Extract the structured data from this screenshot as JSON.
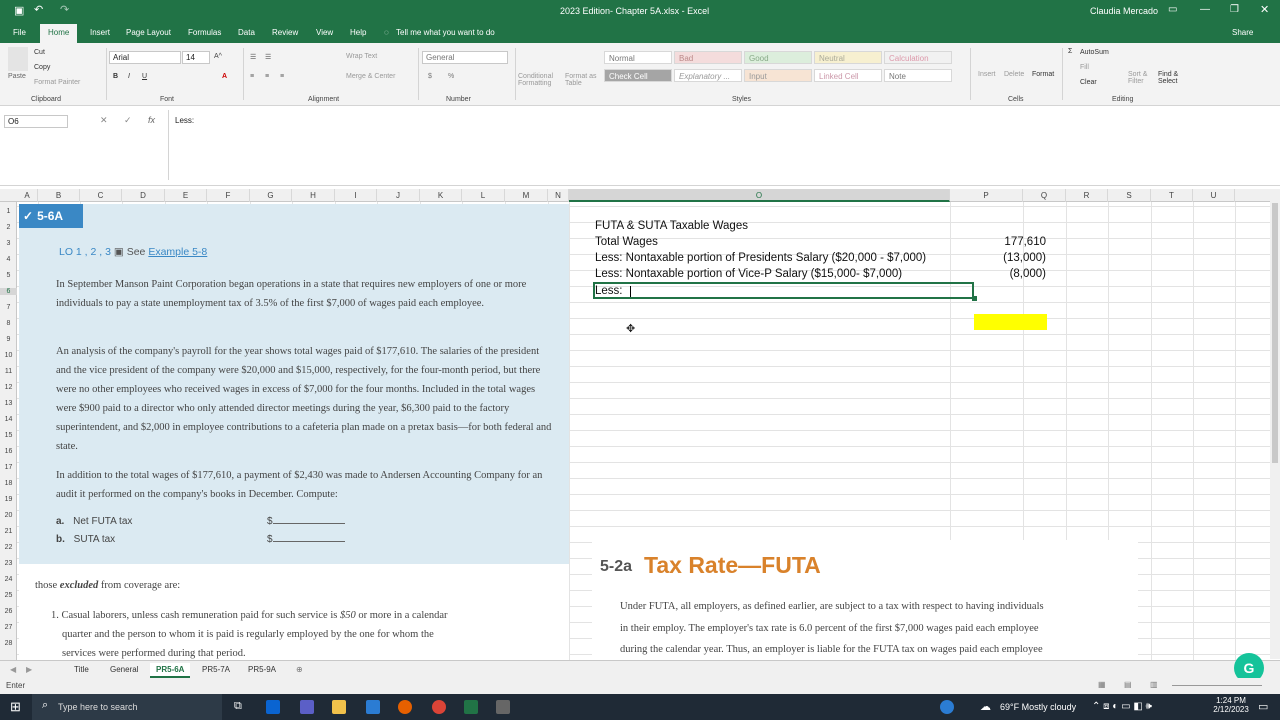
{
  "window": {
    "title": "2023 Edition- Chapter 5A.xlsx  -  Excel",
    "user": "Claudia Mercado"
  },
  "ribbon_tabs": [
    "File",
    "Home",
    "Insert",
    "Page Layout",
    "Formulas",
    "Data",
    "Review",
    "View",
    "Help"
  ],
  "tell_me": "Tell me what you want to do",
  "share": "Share",
  "ribbon": {
    "clipboard": {
      "cut": "Cut",
      "copy": "Copy",
      "format_painter": "Format Painter",
      "paste": "Paste",
      "label": "Clipboard"
    },
    "font": {
      "name": "Arial",
      "size": "14",
      "label": "Font"
    },
    "alignment": {
      "wrap": "Wrap Text",
      "merge": "Merge & Center",
      "label": "Alignment"
    },
    "number": {
      "format": "General",
      "label": "Number"
    },
    "styles": {
      "cond": "Conditional Formatting",
      "table": "Format as Table",
      "cells": [
        "Normal",
        "Bad",
        "Good",
        "Neutral",
        "Calculation",
        "Check Cell",
        "Explanatory ...",
        "Input",
        "Linked Cell",
        "Note"
      ],
      "label": "Styles"
    },
    "cells": {
      "insert": "Insert",
      "delete": "Delete",
      "format": "Format",
      "label": "Cells"
    },
    "editing": {
      "autosum": "AutoSum",
      "fill": "Fill",
      "clear": "Clear",
      "sort": "Sort & Filter",
      "find": "Find & Select",
      "label": "Editing"
    }
  },
  "formula_bar": {
    "name_box": "O6",
    "content": "Less:"
  },
  "columns": [
    "A",
    "B",
    "C",
    "D",
    "E",
    "F",
    "G",
    "H",
    "I",
    "J",
    "K",
    "L",
    "M",
    "N",
    "O",
    "P",
    "Q",
    "R",
    "S",
    "T",
    "U"
  ],
  "rows": [
    "1",
    "2",
    "3",
    "4",
    "5",
    "6",
    "7",
    "8",
    "9",
    "10",
    "11",
    "12",
    "13",
    "14",
    "15",
    "16",
    "17",
    "18",
    "19",
    "20",
    "21",
    "22",
    "23",
    "24",
    "25",
    "26",
    "27",
    "28"
  ],
  "book": {
    "badge": "5-6A",
    "lo": "LO 1 , 2 , 3",
    "see": "See",
    "example": "Example 5-8",
    "para1": "In September Manson Paint Corporation began operations in a state that requires new employers of one or more individuals to pay a state unemployment tax of 3.5% of the first $7,000 of wages paid each employee.",
    "para2": "An analysis of the company's payroll for the year shows total wages paid of $177,610. The salaries of the president and the vice president of the company were $20,000 and $15,000, respectively, for the four-month period, but there were no other employees who received wages in excess of $7,000 for the four months. Included in the total wages were $900 paid to a director who only attended director meetings during the year, $6,300 paid to the factory superintendent, and $2,000 in employee contributions to a cafeteria plan made on a pretax basis—for both federal and state.",
    "para3": "In addition to the total wages of $177,610, a payment of $2,430 was made to Andersen Accounting Company for an audit it performed on the company's books in December. Compute:",
    "qa_letter": "a.",
    "qa_text": "Net FUTA tax",
    "qb_letter": "b.",
    "qb_text": "SUTA tax",
    "dollar": "$",
    "excluded_a": "those",
    "excluded_em": "excluded",
    "excluded_b": "from coverage are:",
    "item1_a": "1.  Casual laborers, unless cash remuneration paid for such service is",
    "item1_em": "$50",
    "item1_b": "or more in a calendar",
    "item1_c": "quarter and the person to whom it is paid is regularly employed by the one for whom the",
    "item1_d": "services were performed during that period."
  },
  "book2": {
    "section_num": "5-2a",
    "section_title": "Tax Rate—FUTA",
    "line1": "Under FUTA, all employers, as defined earlier, are subject to a tax with respect to having individuals",
    "line2": "in their employ. The employer's tax rate is 6.0 percent of the first $7,000 wages paid each employee",
    "line3": "during the calendar year. Thus, an employer is liable for the FUTA tax on wages paid each employee"
  },
  "sheet": {
    "heading": "FUTA & SUTA Taxable Wages",
    "r3_label": "Total Wages",
    "r3_value": "177,610",
    "r4_label": "Less: Nontaxable portion of Presidents Salary ($20,000 - $7,000)",
    "r4_value": "(13,000)",
    "r5_label": "Less: Nontaxable portion of Vice-P Salary ($15,000- $7,000)",
    "r5_value": "(8,000)",
    "r6_label": "Less:",
    "highlight_color": "#ffff00"
  },
  "sheet_tabs": [
    "Title",
    "General",
    "PR5-6A",
    "PR5-7A",
    "PR5-9A"
  ],
  "active_sheet": "PR5-6A",
  "status": "Enter",
  "taskbar": {
    "search": "Type here to search",
    "weather": "69°F  Mostly cloudy",
    "time": "1:24 PM",
    "date": "2/12/2023"
  }
}
